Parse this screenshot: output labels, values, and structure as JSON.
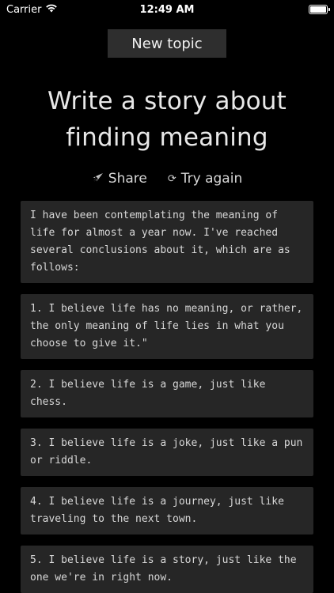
{
  "status_bar": {
    "carrier": "Carrier",
    "time": "12:49 AM",
    "wifi_icon": "wifi-icon",
    "battery_icon": "battery-icon",
    "battery_level": 1.0
  },
  "header": {
    "new_topic_label": "New topic"
  },
  "title": {
    "line1": "Write a story about",
    "line2": "finding meaning"
  },
  "actions": {
    "share_label": "Share",
    "share_icon": "rocket-icon",
    "try_again_label": "Try again",
    "try_again_icon": "refresh-icon"
  },
  "cards": [
    "I have been contemplating the meaning of life for almost a year now. I've reached several conclusions about it, which are as follows:",
    "1. I believe life has no meaning, or rather, the only meaning of life lies in what you choose to give it.\"",
    "2. I believe life is a game, just like chess.",
    "3. I believe life is a joke, just like a pun or riddle.",
    "4. I believe life is a journey, just like traveling to the next town.",
    "5. I believe life is a story, just like the one we're in right now."
  ],
  "colors": {
    "background": "#000000",
    "card_background": "#262626",
    "button_background": "#2e2e2e",
    "text": "#e6e6e6"
  }
}
